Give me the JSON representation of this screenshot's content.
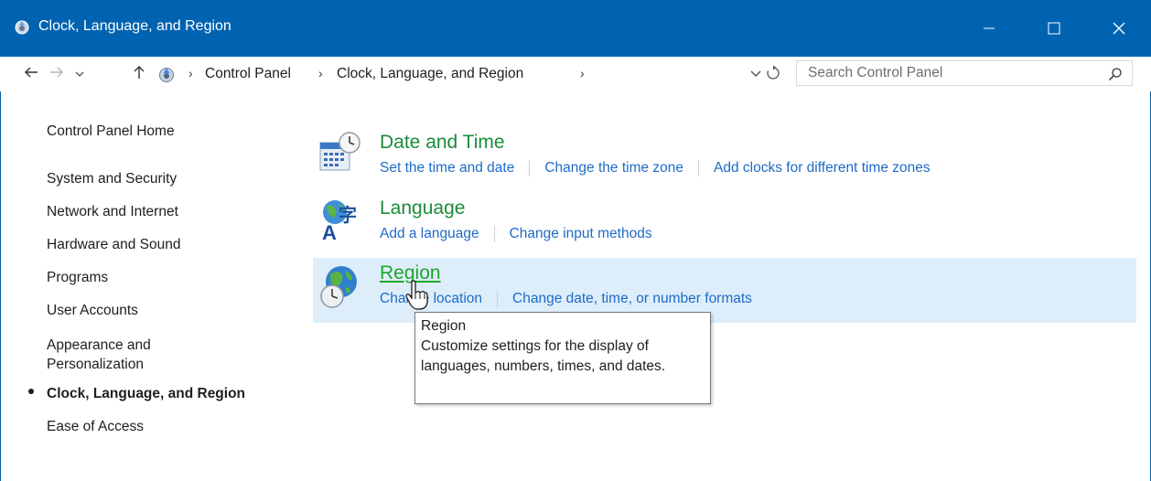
{
  "window": {
    "title": "Clock, Language, and Region",
    "icons": {
      "app": "control-panel-icon",
      "minimize": "minimize-icon",
      "maximize": "maximize-icon",
      "close": "close-icon"
    }
  },
  "address": {
    "breadcrumbs": [
      "Control Panel",
      "Clock, Language, and Region"
    ],
    "search_placeholder": "Search Control Panel"
  },
  "sidebar": {
    "items": [
      {
        "label": "Control Panel Home"
      },
      {
        "label": "System and Security"
      },
      {
        "label": "Network and Internet"
      },
      {
        "label": "Hardware and Sound"
      },
      {
        "label": "Programs"
      },
      {
        "label": "User Accounts"
      },
      {
        "label": "Appearance and Personalization"
      },
      {
        "label": "Clock, Language, and Region",
        "active": true
      },
      {
        "label": "Ease of Access"
      }
    ]
  },
  "categories": [
    {
      "title": "Date and Time",
      "icon": "date-time-icon",
      "links": [
        "Set the time and date",
        "Change the time zone",
        "Add clocks for different time zones"
      ]
    },
    {
      "title": "Language",
      "icon": "language-icon",
      "links": [
        "Add a language",
        "Change input methods"
      ]
    },
    {
      "title": "Region",
      "icon": "region-globe-icon",
      "hovered": true,
      "links": [
        "Change location",
        "Change date, time, or number formats"
      ]
    }
  ],
  "tooltip": {
    "title": "Region",
    "text": "Customize settings for the display of languages, numbers, times, and dates."
  },
  "colors": {
    "titlebar": "#0063b1",
    "category_title": "#1a8c39",
    "link": "#1f6bc6",
    "hover_bg": "#ddeefa"
  }
}
